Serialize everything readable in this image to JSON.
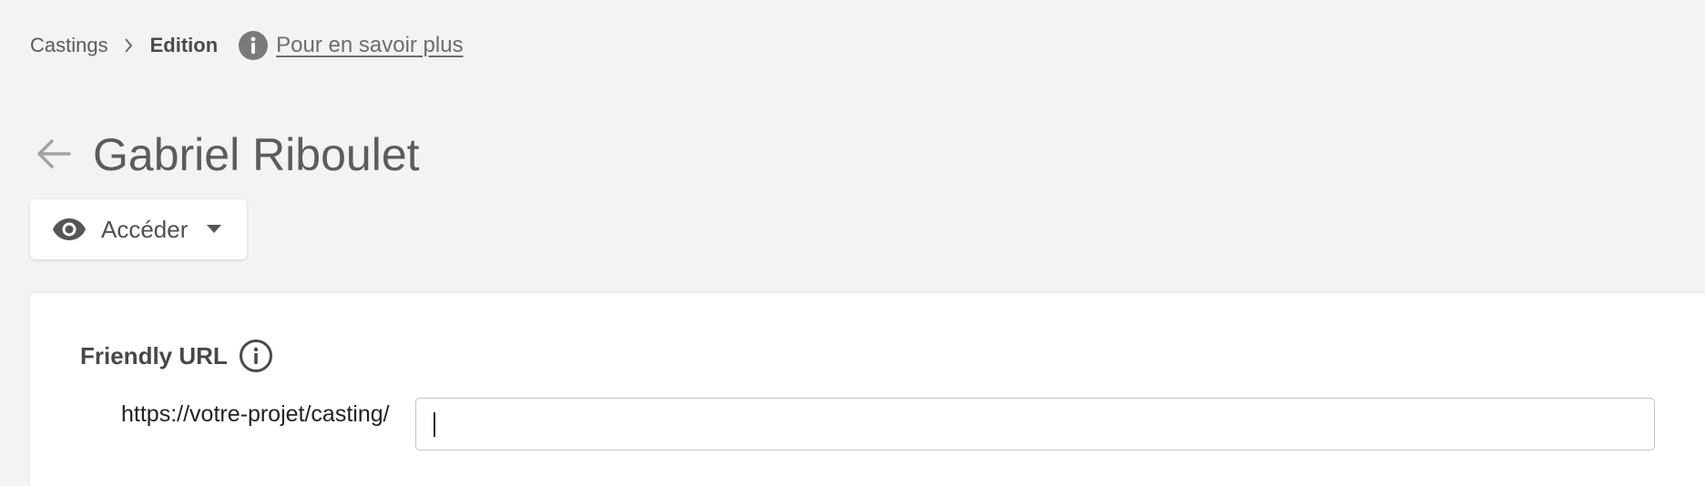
{
  "breadcrumb": {
    "root": "Castings",
    "current": "Edition",
    "help_link": "Pour en savoir plus"
  },
  "header": {
    "title": "Gabriel Riboulet"
  },
  "actions": {
    "access_label": "Accéder"
  },
  "friendly_url": {
    "label": "Friendly URL",
    "prefix": "https://votre-projet/casting/",
    "value": ""
  },
  "icons": {
    "breadcrumb_separator": "chevron-right-icon",
    "help": "info-icon",
    "back": "arrow-left-icon",
    "access": "eye-icon",
    "dropdown": "caret-down-icon",
    "field_info": "info-outline-icon"
  },
  "colors": {
    "background": "#f3f3f3",
    "card": "#ffffff",
    "icon_grey": "#7a7a7a"
  }
}
